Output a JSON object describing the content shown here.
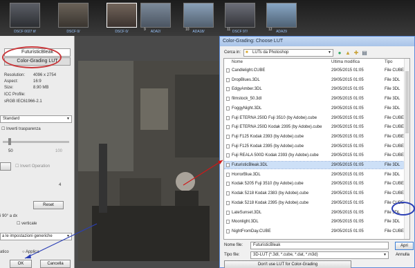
{
  "filmstrip": {
    "thumbs": [
      {
        "caption": "DSCF 0027 tif"
      },
      {
        "caption": "DSCF 0/"
      },
      {
        "caption": "DSCF 0/"
      },
      {
        "caption": "ADA2/"
      },
      {
        "caption": "ADA18/"
      },
      {
        "caption": "DSCF 97/"
      },
      {
        "caption": "ADA29"
      }
    ],
    "numbers": [
      "9",
      "10",
      "11",
      "12"
    ]
  },
  "left_panel": {
    "lut_name": "FuturisticBleak",
    "lut_type": "Color-Grading LUT",
    "info": [
      {
        "label": "Resolution:",
        "value": "4096 x 2754"
      },
      {
        "label": "Aspect:",
        "value": "16:9"
      },
      {
        "label": "Size:",
        "value": "8.90 MB"
      }
    ],
    "icc_label": "ICC Profile:",
    "icc_value": "sRGB IEC61966-2.1",
    "mode": "Standard",
    "invert_transparency": "Inverti trasparenza",
    "slider_min": "50",
    "slider_max": "100",
    "invert_operation": "Invert Operation",
    "count": "4",
    "reset": "Reset",
    "rotate": "i 90° a dx",
    "vertical": "verticale",
    "settings": "a le impostazioni generiche",
    "auto": "atico",
    "apply": "Applica",
    "ok": "OK",
    "cancel": "Cancella"
  },
  "dialog": {
    "title": "Color-Grading: Choose LUT",
    "look_in_label": "Cerca in:",
    "look_in_value": "LUTs da Photoshop",
    "columns": [
      "Nome",
      "Ultima modifica",
      "Tipo"
    ],
    "files": [
      {
        "name": "Candlelight.CUBE",
        "date": "29/05/2015 01:05",
        "type": "File CUBE"
      },
      {
        "name": "DropBlues.3DL",
        "date": "29/05/2015 01:05",
        "type": "File 3DL"
      },
      {
        "name": "EdgyAmber.3DL",
        "date": "29/05/2015 01:05",
        "type": "File 3DL"
      },
      {
        "name": "filmstock_50.3dl",
        "date": "29/05/2015 01:05",
        "type": "File 3DL"
      },
      {
        "name": "FoggyNight.3DL",
        "date": "29/05/2015 01:05",
        "type": "File 3DL"
      },
      {
        "name": "Fuji ETERNA 250D Fuji 3510 (by Adobe).cube",
        "date": "29/05/2015 01:05",
        "type": "File CUBE"
      },
      {
        "name": "Fuji ETERNA 250D Kodak 2395 (by Adobe).cube",
        "date": "29/05/2015 01:05",
        "type": "File CUBE"
      },
      {
        "name": "Fuji F125 Kodak 2393 (by Adobe).cube",
        "date": "29/05/2015 01:05",
        "type": "File CUBE"
      },
      {
        "name": "Fuji F125 Kodak 2395 (by Adobe).cube",
        "date": "29/05/2015 01:05",
        "type": "File CUBE"
      },
      {
        "name": "Fuji REALA 500D Kodak 2393 (by Adobe).cube",
        "date": "29/05/2015 01:05",
        "type": "File CUBE"
      },
      {
        "name": "FuturisticBleak.3DL",
        "date": "29/05/2015 01:05",
        "type": "File 3DL"
      },
      {
        "name": "HorrorBlue.3DL",
        "date": "29/05/2015 01:05",
        "type": "File 3DL"
      },
      {
        "name": "Kodak 5205 Fuji 3510 (by Adobe).cube",
        "date": "29/05/2015 01:05",
        "type": "File CUBE"
      },
      {
        "name": "Kodak 5218 Kodak 2383 (by Adobe).cube",
        "date": "29/05/2015 01:05",
        "type": "File CUBE"
      },
      {
        "name": "Kodak 5218 Kodak 2395 (by Adobe).cube",
        "date": "29/05/2015 01:05",
        "type": "File CUBE"
      },
      {
        "name": "LateSunset.3DL",
        "date": "29/05/2015 01:05",
        "type": "File 3DL"
      },
      {
        "name": "Moonlight.3DL",
        "date": "29/05/2015 01:05",
        "type": "File 3DL"
      },
      {
        "name": "NightFromDay.CUBE",
        "date": "29/05/2015 01:05",
        "type": "File CUBE"
      }
    ],
    "selected_index": 10,
    "filename_label": "Nome file:",
    "filename_value": "FuturisticBleak",
    "filetype_label": "Tipo file:",
    "filetype_value": "3D-LUT (*.3dl, *.cube, *.dat, *.m3d)",
    "open": "Apri",
    "cancel": "Annulla",
    "dont_use": "Don't use LUT for Color-Grading"
  },
  "colors": {
    "highlight_ellipse": "#c9373a",
    "annotation_circle": "#2b3fb5",
    "selection": "#cde0f7"
  }
}
